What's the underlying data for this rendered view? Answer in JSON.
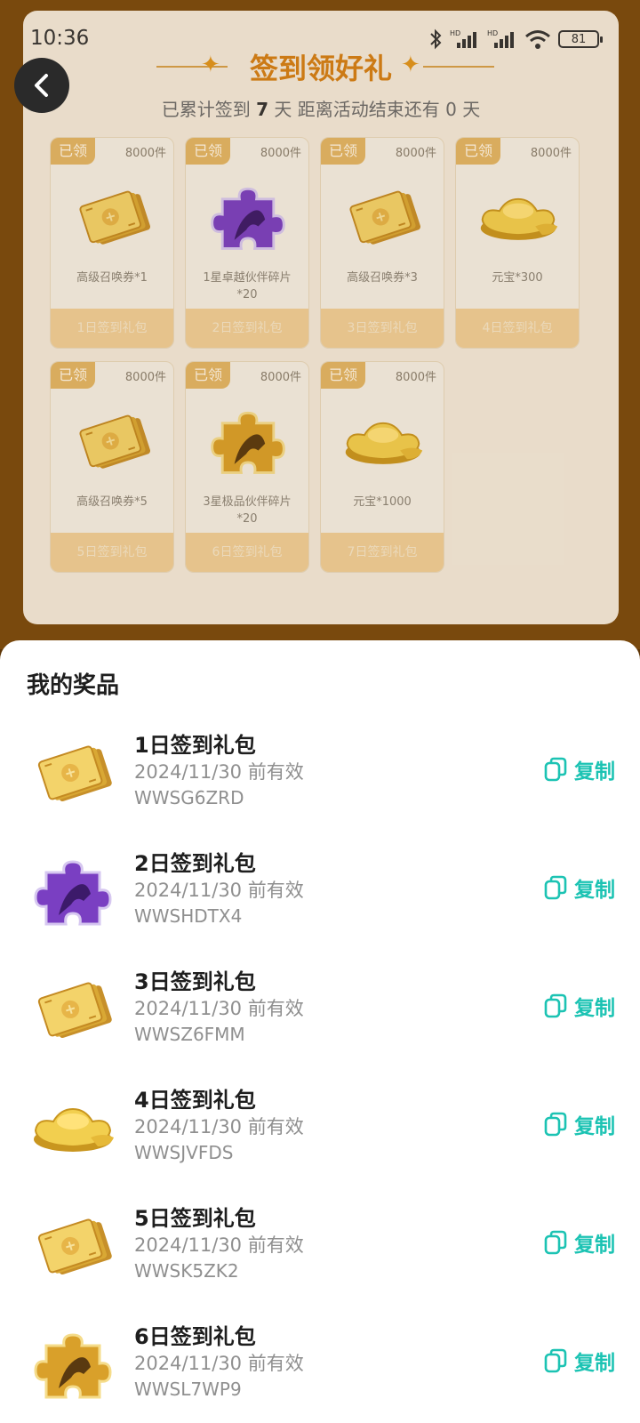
{
  "status": {
    "time": "10:36",
    "battery": "81",
    "net1": "HD",
    "net2": "HD"
  },
  "header": {
    "title": "签到领好礼",
    "subtitle_prefix": "已累计签到",
    "days_signed": "7",
    "subtitle_mid": "天  距离活动结束还有",
    "days_left": "0",
    "subtitle_suffix": "天"
  },
  "rewards": [
    {
      "tag": "已领",
      "count": "8000件",
      "name": "高级召唤券*1",
      "label": "1日签到礼包",
      "icon": "gold-ticket-icon"
    },
    {
      "tag": "已领",
      "count": "8000件",
      "name": "1星卓越伙伴碎片*20",
      "label": "2日签到礼包",
      "icon": "purple-puzzle-icon"
    },
    {
      "tag": "已领",
      "count": "8000件",
      "name": "高级召唤券*3",
      "label": "3日签到礼包",
      "icon": "gold-ticket-icon"
    },
    {
      "tag": "已领",
      "count": "8000件",
      "name": "元宝*300",
      "label": "4日签到礼包",
      "icon": "gold-ingot-icon"
    },
    {
      "tag": "已领",
      "count": "8000件",
      "name": "高级召唤券*5",
      "label": "5日签到礼包",
      "icon": "gold-ticket-icon"
    },
    {
      "tag": "已领",
      "count": "8000件",
      "name": "3星极品伙伴碎片*20",
      "label": "6日签到礼包",
      "icon": "gold-puzzle-icon"
    },
    {
      "tag": "已领",
      "count": "8000件",
      "name": "元宝*1000",
      "label": "7日签到礼包",
      "icon": "gold-ingot-icon"
    }
  ],
  "sheet": {
    "title": "我的奖品",
    "copy_label": "复制",
    "items": [
      {
        "name": "1日签到礼包",
        "expiry": "2024/11/30 前有效",
        "code": "WWSG6ZRD",
        "icon": "gold-ticket-icon"
      },
      {
        "name": "2日签到礼包",
        "expiry": "2024/11/30 前有效",
        "code": "WWSHDTX4",
        "icon": "purple-puzzle-icon"
      },
      {
        "name": "3日签到礼包",
        "expiry": "2024/11/30 前有效",
        "code": "WWSZ6FMM",
        "icon": "gold-ticket-icon"
      },
      {
        "name": "4日签到礼包",
        "expiry": "2024/11/30 前有效",
        "code": "WWSJVFDS",
        "icon": "gold-ingot-icon"
      },
      {
        "name": "5日签到礼包",
        "expiry": "2024/11/30 前有效",
        "code": "WWSK5ZK2",
        "icon": "gold-ticket-icon"
      },
      {
        "name": "6日签到礼包",
        "expiry": "2024/11/30 前有效",
        "code": "WWSL7WP9",
        "icon": "gold-puzzle-icon"
      }
    ]
  },
  "colors": {
    "accent": "#1cc3b3",
    "title_orange": "#d47f16",
    "tag_gold": "#e2b665"
  }
}
